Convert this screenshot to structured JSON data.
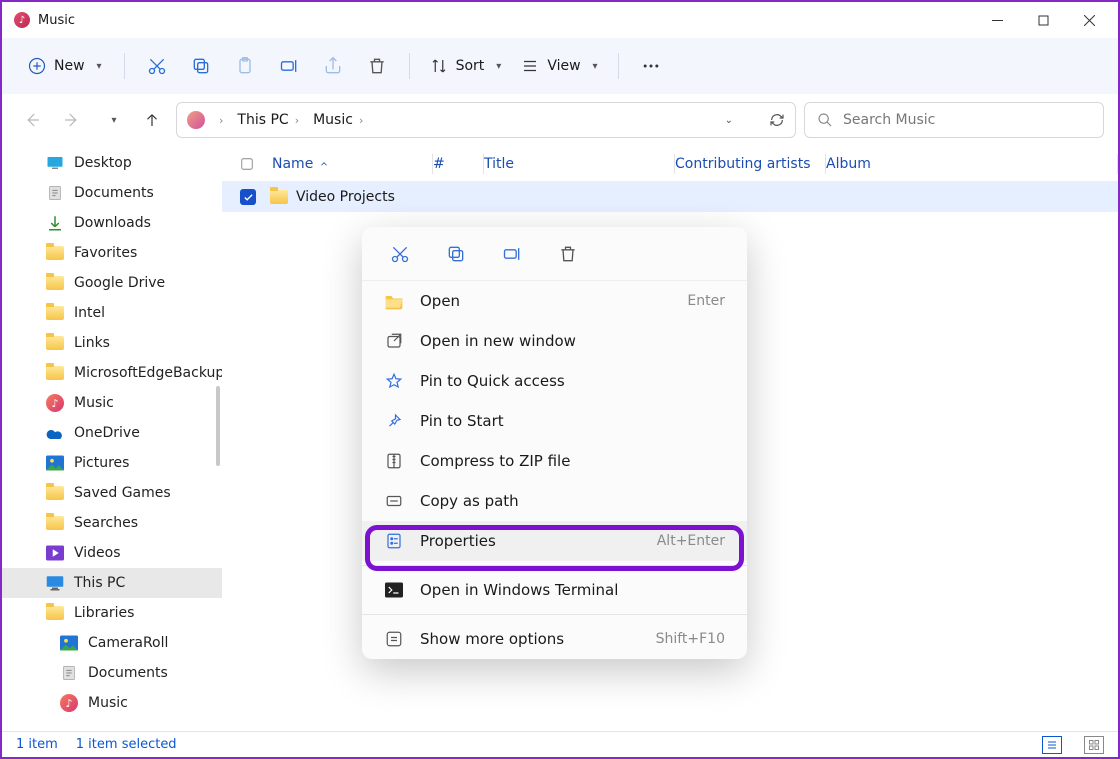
{
  "window": {
    "title": "Music"
  },
  "toolbar": {
    "new_label": "New",
    "sort_label": "Sort",
    "view_label": "View"
  },
  "breadcrumbs": [
    "This PC",
    "Music"
  ],
  "search": {
    "placeholder": "Search Music"
  },
  "sidebar": {
    "items": [
      {
        "label": "Desktop",
        "icon": "desktop"
      },
      {
        "label": "Documents",
        "icon": "doc"
      },
      {
        "label": "Downloads",
        "icon": "down"
      },
      {
        "label": "Favorites",
        "icon": "folder"
      },
      {
        "label": "Google Drive",
        "icon": "folder"
      },
      {
        "label": "Intel",
        "icon": "folder"
      },
      {
        "label": "Links",
        "icon": "folder"
      },
      {
        "label": "MicrosoftEdgeBackups",
        "icon": "folder"
      },
      {
        "label": "Music",
        "icon": "music"
      },
      {
        "label": "OneDrive",
        "icon": "cloud"
      },
      {
        "label": "Pictures",
        "icon": "pictures"
      },
      {
        "label": "Saved Games",
        "icon": "folder"
      },
      {
        "label": "Searches",
        "icon": "folder"
      },
      {
        "label": "Videos",
        "icon": "videos"
      },
      {
        "label": "This PC",
        "icon": "pc",
        "selected": true
      },
      {
        "label": "Libraries",
        "icon": "folder"
      },
      {
        "label": "CameraRoll",
        "icon": "pictures",
        "lvl": 2
      },
      {
        "label": "Documents",
        "icon": "doc",
        "lvl": 2
      },
      {
        "label": "Music",
        "icon": "music",
        "lvl": 2
      }
    ]
  },
  "columns": {
    "name": "Name",
    "num": "#",
    "title": "Title",
    "artists": "Contributing artists",
    "album": "Album"
  },
  "rows": [
    {
      "name": "Video Projects",
      "checked": true
    }
  ],
  "context_menu": {
    "items": [
      {
        "label": "Open",
        "hint": "Enter",
        "icon": "folder-open"
      },
      {
        "label": "Open in new window",
        "icon": "new-window"
      },
      {
        "label": "Pin to Quick access",
        "icon": "star"
      },
      {
        "label": "Pin to Start",
        "icon": "pin"
      },
      {
        "label": "Compress to ZIP file",
        "icon": "zip"
      },
      {
        "label": "Copy as path",
        "icon": "path"
      },
      {
        "label": "Properties",
        "hint": "Alt+Enter",
        "icon": "properties",
        "highlighted": true
      },
      {
        "label": "Open in Windows Terminal",
        "icon": "terminal"
      },
      {
        "label": "Show more options",
        "hint": "Shift+F10",
        "icon": "more"
      }
    ]
  },
  "status": {
    "count": "1 item",
    "selection": "1 item selected"
  }
}
